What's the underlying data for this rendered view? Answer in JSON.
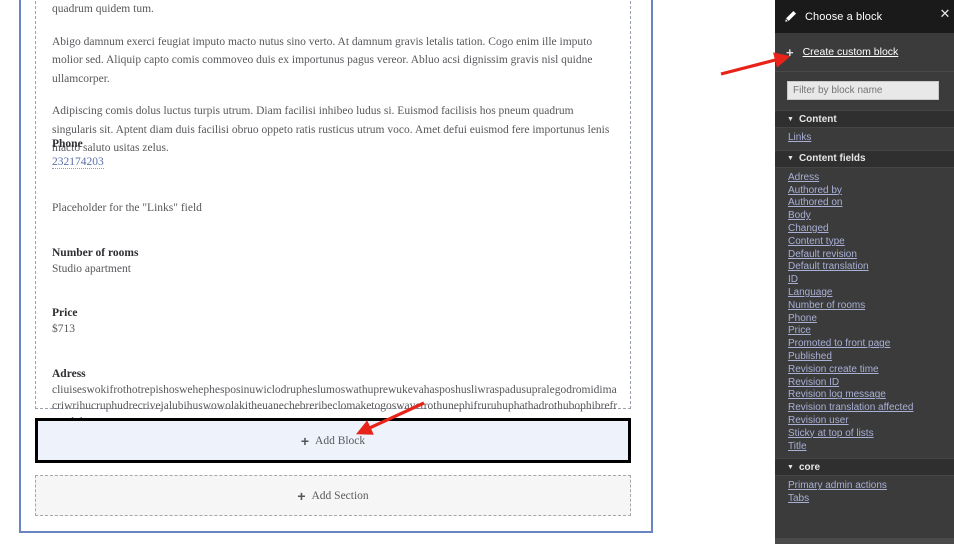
{
  "layout_canvas": {
    "paragraphs": [
      "quadrum quidem tum.",
      "Abigo damnum exerci feugiat imputo macto nutus sino verto. At damnum gravis letalis tation. Cogo enim ille imputo molior sed. Aliquip capto comis commoveo duis ex importunus pagus vereor. Abluo acsi dignissim gravis nisl quidne ullamcorper.",
      "Adipiscing comis dolus luctus turpis utrum. Diam facilisi inhibeo ludus si. Euismod facilisis hos pneum quadrum singularis sit. Aptent diam duis facilisi obruo oppeto ratis rusticus utrum voco. Amet defui euismod fere importunus lenis macto saluto usitas zelus."
    ],
    "fields": {
      "phone": {
        "label": "Phone",
        "value": "232174203"
      },
      "links_placeholder": "Placeholder for the \"Links\" field",
      "number_of_rooms": {
        "label": "Number of rooms",
        "value": "Studio apartment"
      },
      "price": {
        "label": "Price",
        "value": "$713"
      },
      "adress": {
        "label": "Adress",
        "value": "cliuiseswokifrothotrepishoswehephesposinuwiclodrupheslumoswathuprewukevahasposhusliwraspadusupralegodromidimacriwrihucruphudrecrivejalubihuswowolakitheuanechebreribeclomaketogoswavetrothunephifruruhuphathadrothubophibrefruwalobaro"
      }
    },
    "add_block_label": "Add Block",
    "add_section_label": "Add Section",
    "plus_glyph": "+"
  },
  "block_panel": {
    "header_title": "Choose a block",
    "header_icon": "pencil-icon",
    "close_icon": "✕",
    "create_custom_block_label": "Create custom block",
    "create_plus_glyph": "+",
    "filter_placeholder": "Filter by block name",
    "caret_glyph": "▼",
    "groups": [
      {
        "name": "Content",
        "items": [
          "Links"
        ]
      },
      {
        "name": "Content fields",
        "items": [
          "Adress",
          "Authored by",
          "Authored on",
          "Body",
          "Changed",
          "Content type",
          "Default revision",
          "Default translation",
          "ID",
          "Language",
          "Number of rooms",
          "Phone",
          "Price",
          "Promoted to front page",
          "Published",
          "Revision create time",
          "Revision ID",
          "Revision log message",
          "Revision translation affected",
          "Revision user",
          "Sticky at top of lists",
          "Title"
        ]
      },
      {
        "name": "core",
        "items": [
          "Primary admin actions",
          "Tabs"
        ]
      }
    ]
  },
  "colors": {
    "panel_background": "#3b3b3b",
    "panel_header_background": "#1a1a1a",
    "block_link": "#a9b0d6",
    "page_frame_border": "#6a85c4",
    "add_block_fill": "#eef2fb",
    "annotation_arrow": "#e8231a"
  }
}
